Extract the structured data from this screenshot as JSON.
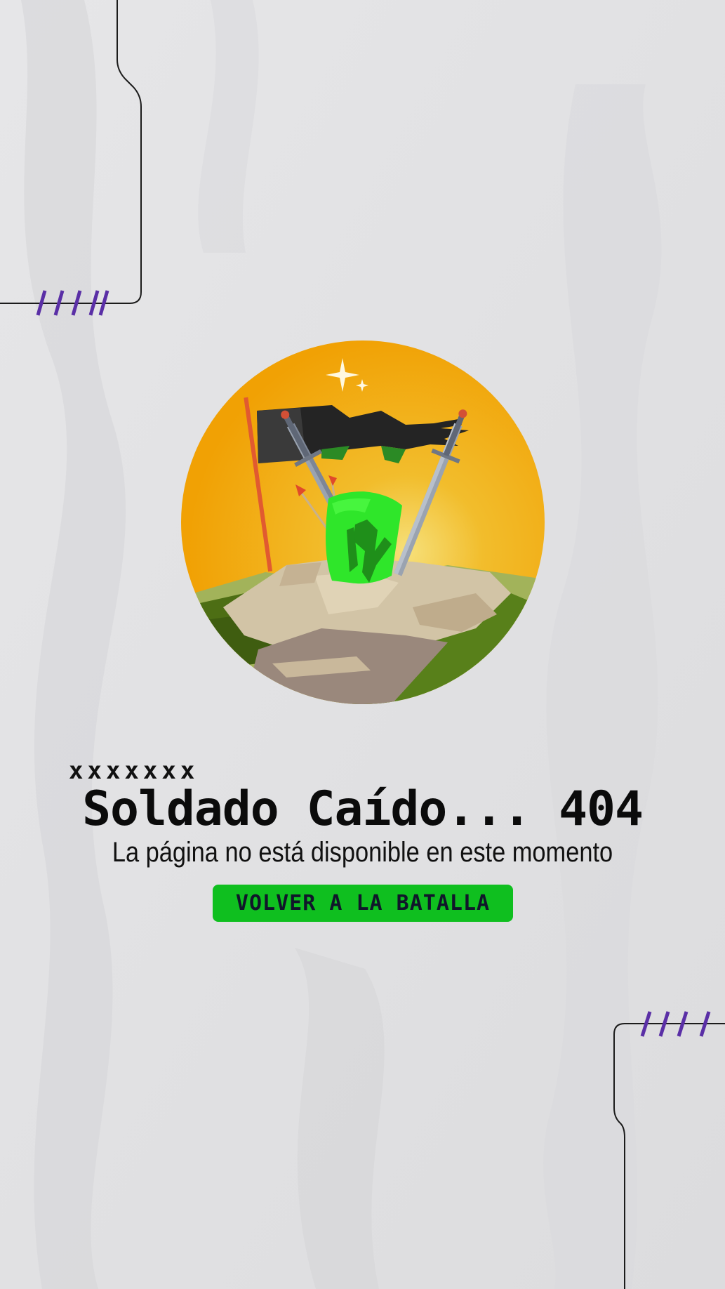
{
  "page": {
    "tag": "xxxxxxx",
    "title": "Soldado Caído... 404",
    "subtitle": "La página no está disponible en este momento",
    "button_label": "VOLVER A LA BATALLA"
  },
  "colors": {
    "background": "#e2e2e4",
    "accent_purple": "#5a2fa6",
    "button_green": "#0fbf1f",
    "sun_orange": "#f1a104",
    "helmet_green": "#2fe62a"
  },
  "decorations": {
    "slashes_top": "////",
    "slashes_bottom": "////"
  }
}
